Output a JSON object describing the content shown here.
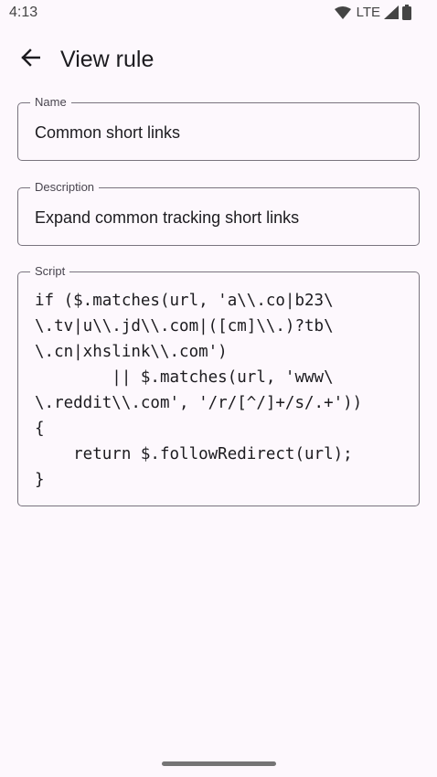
{
  "status_bar": {
    "time": "4:13",
    "network": "LTE",
    "icons": [
      "wifi-icon",
      "signal-icon",
      "battery-icon"
    ]
  },
  "app_bar": {
    "back_icon": "arrow-back-icon",
    "title": "View rule"
  },
  "form": {
    "name": {
      "label": "Name",
      "value": "Common short links"
    },
    "description": {
      "label": "Description",
      "value": "Expand common tracking short links"
    },
    "script": {
      "label": "Script",
      "value": "if ($.matches(url, 'a\\\\.co|b23\\\n\\.tv|u\\\\.jd\\\\.com|([cm]\\\\.)?tb\\\n\\.cn|xhslink\\\\.com')\n        || $.matches(url, 'www\\\n\\.reddit\\\\.com', '/r/[^/]+/s/.+'))\n{\n    return $.followRedirect(url);\n}"
    }
  },
  "colors": {
    "background": "#fdf8fd",
    "outline": "#79747e",
    "text": "#1c1b1f",
    "label": "#49454f"
  }
}
